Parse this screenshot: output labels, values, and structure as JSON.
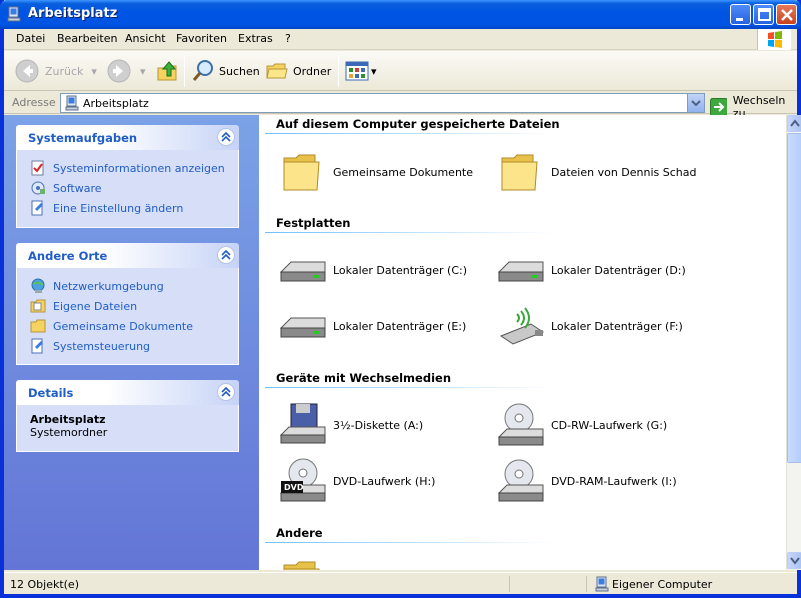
{
  "window": {
    "title": "Arbeitsplatz"
  },
  "menu": [
    "Datei",
    "Bearbeiten",
    "Ansicht",
    "Favoriten",
    "Extras",
    "?"
  ],
  "toolbar": {
    "back": "Zurück",
    "search": "Suchen",
    "folders": "Ordner"
  },
  "address": {
    "label": "Adresse",
    "value": "Arbeitsplatz",
    "go": "Wechseln zu"
  },
  "left": {
    "panels": [
      {
        "title": "Systemaufgaben",
        "links": [
          "Systeminformationen anzeigen",
          "Software",
          "Eine Einstellung ändern"
        ]
      },
      {
        "title": "Andere Orte",
        "links": [
          "Netzwerkumgebung",
          "Eigene Dateien",
          "Gemeinsame Dokumente",
          "Systemsteuerung"
        ]
      },
      {
        "title": "Details",
        "name": "Arbeitsplatz",
        "type": "Systemordner"
      }
    ]
  },
  "main": {
    "groups": [
      {
        "title": "Auf diesem Computer gespeicherte Dateien",
        "items": [
          "Gemeinsame Dokumente",
          "Dateien von Dennis Schad"
        ]
      },
      {
        "title": "Festplatten",
        "items": [
          "Lokaler Datenträger (C:)",
          "Lokaler Datenträger (D:)",
          "Lokaler Datenträger (E:)",
          "Lokaler Datenträger (F:)"
        ]
      },
      {
        "title": "Geräte mit Wechselmedien",
        "items": [
          "3½-Diskette (A:)",
          "CD-RW-Laufwerk (G:)",
          "DVD-Laufwerk (H:)",
          "DVD-RAM-Laufwerk (I:)"
        ]
      },
      {
        "title": "Andere",
        "items": []
      }
    ]
  },
  "status": {
    "count": "12 Objekt(e)",
    "zone": "Eigener Computer"
  },
  "colors": {
    "title_blue": "#0054e3",
    "link_blue": "#215dc6",
    "pane_gradient_top": "#7ba2e7",
    "pane_gradient_bottom": "#6375d6"
  }
}
